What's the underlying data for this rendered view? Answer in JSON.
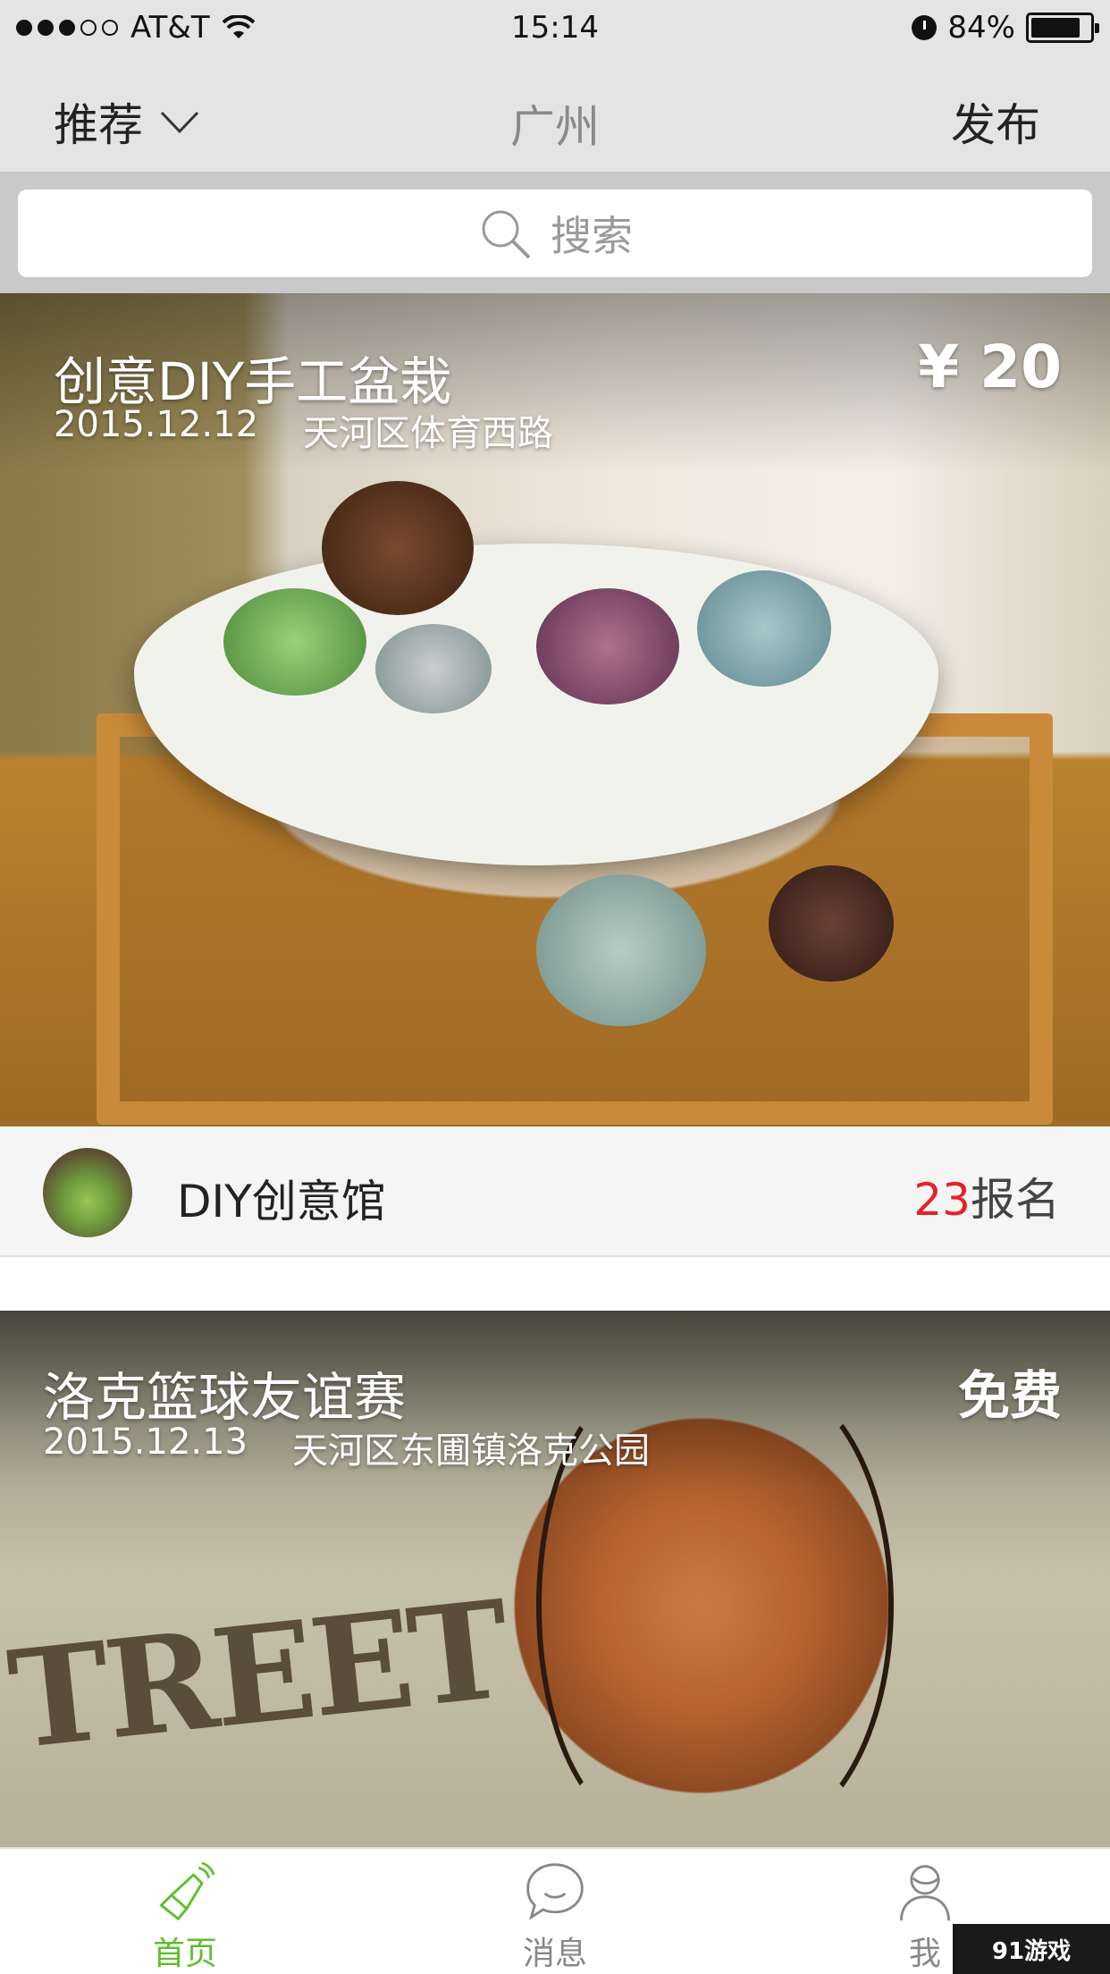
{
  "status_bar": {
    "carrier": "AT&T",
    "time": "15:14",
    "battery_percent": "84%",
    "battery_level": 0.84,
    "signal_bars_filled": 3,
    "signal_bars_total": 5
  },
  "nav": {
    "filter_label": "推荐",
    "city": "广州",
    "publish_label": "发布"
  },
  "search": {
    "placeholder": "搜索"
  },
  "events": [
    {
      "title": "创意DIY手工盆栽",
      "date": "2015.12.12",
      "location": "天河区体育西路",
      "price": "¥ 20",
      "organizer": "DIY创意馆",
      "signup_count": "23",
      "signup_label": "报名"
    },
    {
      "title": "洛克篮球友谊赛",
      "date": "2015.12.13",
      "location": "天河区东圃镇洛克公园",
      "price": "免费",
      "image_text": "TREET"
    }
  ],
  "tabs": [
    {
      "label": "首页",
      "icon": "megaphone-icon",
      "active": true
    },
    {
      "label": "消息",
      "icon": "chat-bubble-icon",
      "active": false
    },
    {
      "label": "我",
      "icon": "person-icon",
      "active": false
    }
  ],
  "colors": {
    "accent_green": "#5cbf2a",
    "signup_red": "#e8202a",
    "bar_gray": "#e4e4e4"
  },
  "watermark": "91游戏"
}
